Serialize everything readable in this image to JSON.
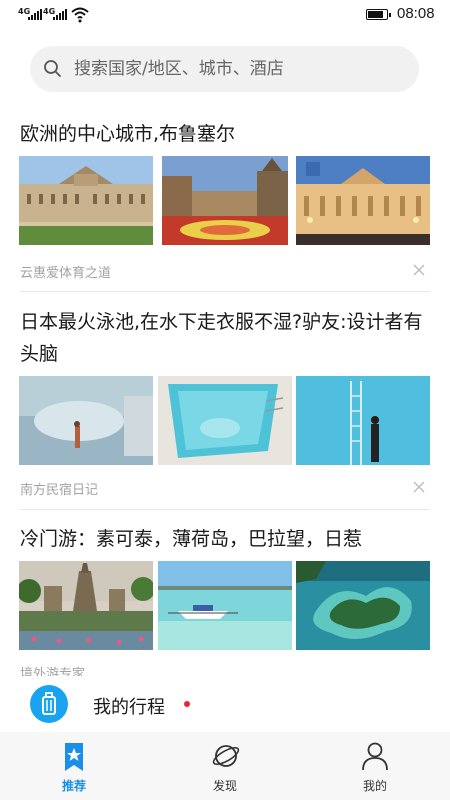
{
  "status_bar": {
    "network_1": "4G",
    "network_2": "4G",
    "time": "08:08",
    "battery_level": 0.9
  },
  "search": {
    "placeholder": "搜索国家/地区、城市、酒店"
  },
  "articles": [
    {
      "title": "欧洲的中心城市,布鲁塞尔",
      "source": "云惠爱体育之道",
      "images": [
        "brussels-royal-palace",
        "brussels-grand-place-flower-carpet",
        "brussels-palace-night"
      ]
    },
    {
      "title": "日本最火泳池,在水下走衣服不湿?驴友:设计者有头脑",
      "source": "南方民宿日记",
      "images": [
        "pool-underwater-view",
        "pool-top-view",
        "pool-ladder-person"
      ]
    },
    {
      "title": "冷门游：素可泰，薄荷岛，巴拉望，日惹",
      "source": "境外游专家",
      "images": [
        "sukhothai-temple",
        "bohol-beach-boat",
        "palawan-island-aerial"
      ]
    }
  ],
  "trip": {
    "label": "我的行程",
    "icon": "luggage-icon"
  },
  "tabs": [
    {
      "label": "推荐",
      "icon": "star-bookmark-icon",
      "active": true
    },
    {
      "label": "发现",
      "icon": "planet-icon",
      "active": false
    },
    {
      "label": "我的",
      "icon": "person-icon",
      "active": false
    }
  ],
  "colors": {
    "accent": "#1a8ee8",
    "trip_icon_bg": "#1aa3ee",
    "notification_dot": "#ee2233"
  }
}
